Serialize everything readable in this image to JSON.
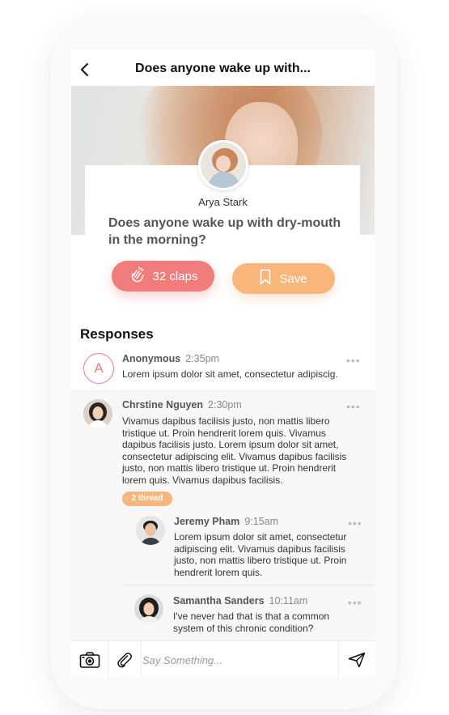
{
  "header": {
    "title": "Does anyone wake up with..."
  },
  "post": {
    "author": "Arya Stark",
    "question": "Does anyone wake up with dry-mouth in the morning?"
  },
  "actions": {
    "claps_label": "32 claps",
    "save_label": "Save"
  },
  "responses": {
    "title": "Responses",
    "items": [
      {
        "avatar_letter": "A",
        "name": "Anonymous",
        "time": "2:35pm",
        "text": "Lorem ipsum dolor sit amet, consectetur adipiscig."
      },
      {
        "name": "Chrstine Nguyen",
        "time": "2:30pm",
        "text": "Vivamus dapibus facilisis justo, non mattis libero tristique ut. Proin hendrerit lorem quis. Vivamus dapibus facilisis justo. Lorem ipsum dolor sit amet, consectetur adipiscing elit. Vivamus dapibus facilisis justo, non mattis libero tristique ut. Proin hendrerit lorem quis. Vivamus dapibus facilisis.",
        "thread_label": "2 thread"
      },
      {
        "name": "Jeremy Pham",
        "time": "9:15am",
        "text": "Lorem ipsum dolor sit amet, consectetur adipiscing elit. Vivamus dapibus facilisis justo, non mattis libero tristique ut. Proin hendrerit lorem quis."
      },
      {
        "name": "Samantha Sanders",
        "time": "10:11am",
        "text": "I've never had that is that a common system of this chronic condition?"
      }
    ]
  },
  "composer": {
    "placeholder": "Say Something..."
  },
  "colors": {
    "clap": "#f07c7c",
    "save": "#f8b57c",
    "accent": "#f07c7c"
  },
  "icons": [
    "back-chevron-icon",
    "clap-icon",
    "bookmark-icon",
    "more-icon",
    "camera-icon",
    "paperclip-icon",
    "send-icon"
  ]
}
